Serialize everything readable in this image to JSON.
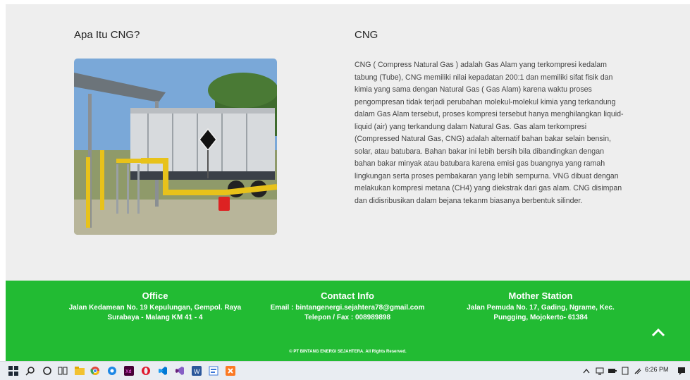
{
  "left_section": {
    "heading": "Apa Itu CNG?"
  },
  "right_section": {
    "heading": "CNG",
    "body": "CNG ( Compress Natural Gas ) adalah Gas Alam yang terkompresi kedalam tabung (Tube), CNG memiliki nilai kepadatan 200:1 dan memiliki sifat fisik dan kimia yang sama dengan Natural Gas ( Gas Alam) karena waktu proses pengompresan tidak terjadi perubahan molekul-molekul kimia yang terkandung dalam Gas Alam tersebut, proses kompresi tersebut hanya menghilangkan liquid-liquid (air) yang terkandung dalam Natural Gas. Gas alam terkompresi (Compressed Natural Gas, CNG) adalah alternatif bahan bakar selain bensin, solar, atau batubara. Bahan bakar ini lebih bersih bila dibandingkan dengan bahan bakar minyak atau batubara karena emisi gas buangnya yang ramah lingkungan serta proses pembakaran yang lebih sempurna. VNG dibuat dengan melakukan kompresi metana (CH4) yang diekstrak dari gas alam. CNG disimpan dan didisribusikan dalam bejana tekanm biasanya berbentuk silinder."
  },
  "footer": {
    "office": {
      "title": "Office",
      "line1": "Jalan Kedamean No. 19 Kepulungan, Gempol. Raya",
      "line2": "Surabaya - Malang KM 41 - 4"
    },
    "contact": {
      "title": "Contact Info",
      "line1": "Email : bintangenergi.sejahtera78@gmail.com",
      "line2": "Telepon / Fax : 008989898"
    },
    "station": {
      "title": "Mother Station",
      "line1": "Jalan Pemuda No. 17, Gading, Ngrame, Kec.",
      "line2": "Pungging, Mojokerto- 61384"
    },
    "copyright": "© PT BINTANG ENERGI SEJAHTERA. All Rights Reserved."
  },
  "taskbar": {
    "time": "6:26 PM"
  },
  "colors": {
    "footer_bg": "#22bb33",
    "page_bg": "#eeeeee",
    "taskbar_bg": "#e9edf2"
  }
}
